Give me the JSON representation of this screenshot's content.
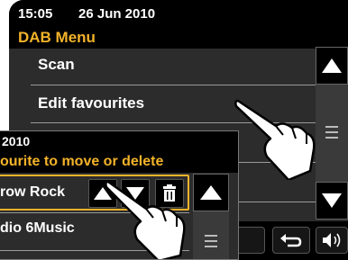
{
  "back_screen": {
    "status": {
      "time": "15:05",
      "date": "26 Jun 2010"
    },
    "menu_title": "DAB Menu",
    "items": [
      {
        "label": "Scan"
      },
      {
        "label": "Edit favourites"
      }
    ],
    "scroll_up_icon": "triangle-up-icon",
    "scroll_down_icon": "triangle-down-icon",
    "back_icon": "back-arrow-icon",
    "volume_icon": "speaker-icon"
  },
  "front_screen": {
    "status_date": "2010",
    "title": "ourite to move or delete",
    "items": [
      {
        "label": "row Rock"
      },
      {
        "label": "dio 6Music"
      }
    ],
    "actions": [
      "move-up-icon",
      "move-down-icon",
      "trash-icon"
    ],
    "colors": {
      "accent": "#f3b32a",
      "panel": "#2c2c2c"
    }
  }
}
